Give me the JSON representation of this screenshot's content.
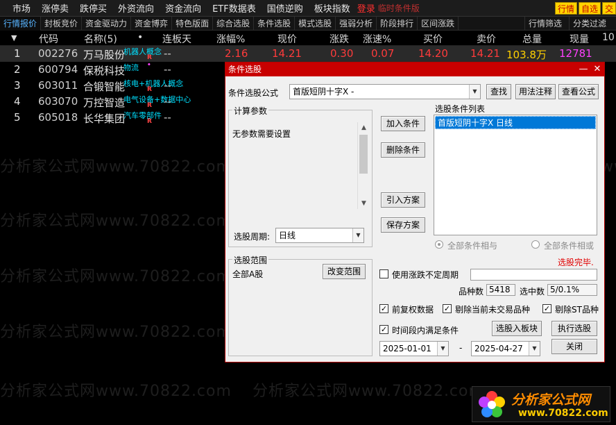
{
  "menu": {
    "items": [
      "市场",
      "涨停卖",
      "跌停买",
      "外资流向",
      "资金流向",
      "ETF数据表",
      "国债逆购",
      "板块指数"
    ],
    "login": "登录",
    "timeout": "临时条件版",
    "right_btns": [
      "行情",
      "自选",
      "交"
    ]
  },
  "tabs": {
    "items": [
      "行情报价",
      "封板竞价",
      "资金驱动力",
      "资金博弈",
      "特色版面",
      "综合选股",
      "条件选股",
      "模式选股",
      "强弱分析",
      "阶段排行",
      "区间涨跌"
    ],
    "right": [
      "行情筛选",
      "分类过滤"
    ]
  },
  "columns": {
    "sort": "▼",
    "code": "代码",
    "name": "名称(5)",
    "dot": "•",
    "limit": "连板天",
    "pct": "涨幅%",
    "price": "现价",
    "chg": "涨跌",
    "speed": "涨速%",
    "bid": "买价",
    "ask": "卖价",
    "vol": "总量",
    "cur": "现量",
    "more": "10"
  },
  "rows": [
    {
      "idx": "1",
      "code": "002276",
      "name": "万马股份",
      "tag": "机器人概念",
      "mark": "R",
      "limit": "--",
      "pct": "2.16",
      "price": "14.21",
      "chg": "0.30",
      "speed": "0.07",
      "bid": "14.20",
      "ask": "14.21",
      "vol": "103.8万",
      "cur": "12781"
    },
    {
      "idx": "2",
      "code": "600794",
      "name": "保税科技",
      "tag": "物流",
      "mark": "•",
      "limit": "--"
    },
    {
      "idx": "3",
      "code": "603011",
      "name": "合锻智能",
      "tag": "核电+机器人概念",
      "mark": "R",
      "limit": "--"
    },
    {
      "idx": "4",
      "code": "603070",
      "name": "万控智造",
      "tag": "电气设备+数据中心",
      "mark": "R",
      "limit": "--"
    },
    {
      "idx": "5",
      "code": "605018",
      "name": "长华集团",
      "tag": "汽车零部件",
      "mark": "R",
      "limit": "--"
    }
  ],
  "watermark": {
    "text": "分析家公式网www.70822.com"
  },
  "logo": {
    "title": "分析家公式网",
    "url": "www.70822.com"
  },
  "dialog": {
    "title": "条件选股",
    "formula_label": "条件选股公式",
    "formula_value": "首版短阴十字X  -",
    "btn_find": "查找",
    "btn_usage": "用法注释",
    "btn_view": "查看公式",
    "params_group": "计算参数",
    "params_text": "无参数需要设置",
    "btn_add": "加入条件",
    "btn_delete": "删除条件",
    "btn_import": "引入方案",
    "btn_save": "保存方案",
    "cond_list_label": "选股条件列表",
    "cond_item": "首版短阴十字X  日线",
    "period_label": "选股周期:",
    "period_value": "日线",
    "radio_and": "全部条件相与",
    "radio_or": "全部条件相或",
    "status": "选股完毕.",
    "range_group": "选股范围",
    "range_value": "全部A股",
    "btn_change_range": "改变范围",
    "use_period": "使用涨跌不定周期",
    "count_label": "品种数",
    "count_value": "5418",
    "selected_label": "选中数",
    "selected_value": "5/0.1%",
    "chk_fq": "前复权数据",
    "chk_untraded": "剔除当前未交易品种",
    "chk_st": "剔除ST品种",
    "chk_period": "时间段内满足条件",
    "btn_to_block": "选股入板块",
    "btn_run": "执行选股",
    "date_from": "2025-01-01",
    "date_sep": "-",
    "date_to": "2025-04-27",
    "btn_close": "关闭"
  },
  "colors": {
    "title_red": "#c80000",
    "selection_blue": "#0078d7",
    "quote_red": "#ff3b3b",
    "vol_yellow": "#ffd000",
    "tag_cyan": "#00e0ff"
  }
}
